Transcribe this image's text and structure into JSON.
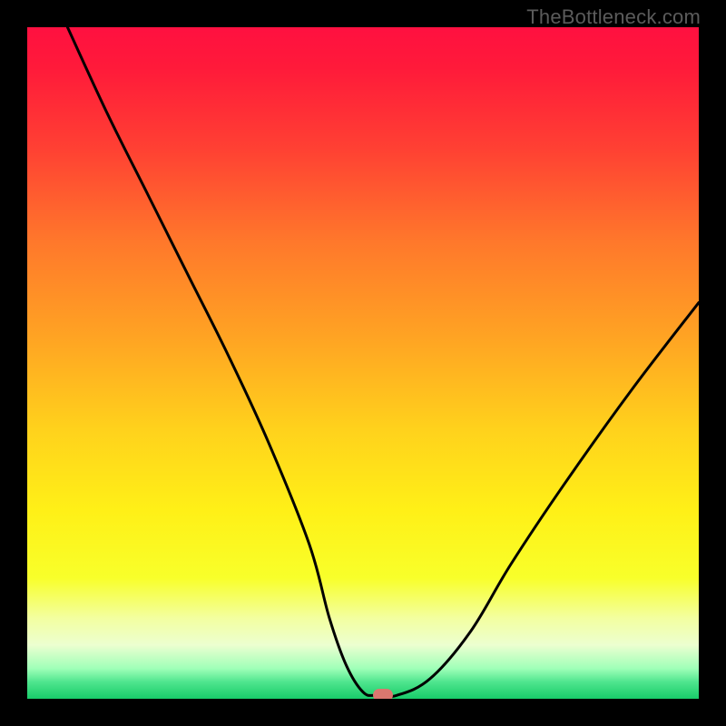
{
  "watermark": "TheBottleneck.com",
  "chart_data": {
    "type": "line",
    "title": "",
    "xlabel": "",
    "ylabel": "",
    "xlim": [
      0,
      100
    ],
    "ylim": [
      0,
      100
    ],
    "grid": false,
    "legend": false,
    "series": [
      {
        "name": "curve",
        "color": "#000000",
        "x": [
          6,
          12,
          18,
          24,
          30,
          36,
          42,
          45,
          47.5,
          50,
          52,
          55,
          60,
          66,
          72,
          80,
          90,
          100
        ],
        "y": [
          100,
          87,
          75,
          63,
          51,
          38,
          23,
          12,
          5,
          1,
          0.5,
          0.5,
          3,
          10,
          20,
          32,
          46,
          59
        ]
      }
    ],
    "marker": {
      "x": 53,
      "y": 0.5,
      "color": "#db776f"
    },
    "background_gradient": [
      {
        "pos": 0.0,
        "color": "#ff1040"
      },
      {
        "pos": 0.06,
        "color": "#ff1a3a"
      },
      {
        "pos": 0.18,
        "color": "#ff4033"
      },
      {
        "pos": 0.32,
        "color": "#ff782b"
      },
      {
        "pos": 0.46,
        "color": "#ffa323"
      },
      {
        "pos": 0.6,
        "color": "#ffd21c"
      },
      {
        "pos": 0.72,
        "color": "#fff017"
      },
      {
        "pos": 0.82,
        "color": "#f8ff2a"
      },
      {
        "pos": 0.88,
        "color": "#f3ffa0"
      },
      {
        "pos": 0.92,
        "color": "#ecffd0"
      },
      {
        "pos": 0.955,
        "color": "#9fffb8"
      },
      {
        "pos": 0.975,
        "color": "#4fe58e"
      },
      {
        "pos": 1.0,
        "color": "#18cc6a"
      }
    ]
  }
}
